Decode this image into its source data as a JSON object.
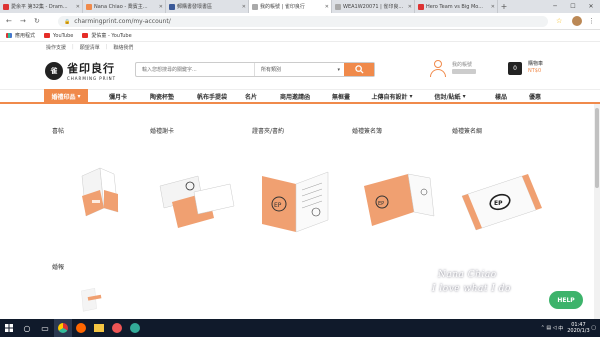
{
  "browser": {
    "tabs": [
      {
        "title": "愛余平 第32集 - Dram...",
        "color": "#d33"
      },
      {
        "title": "Nana Chiao - 喬賓主...",
        "color": "#f08a4b"
      },
      {
        "title": "郵購書發壞書區",
        "color": "#3b5998"
      },
      {
        "title": "我的帳號 | 雀印良行",
        "color": "#888"
      },
      {
        "title": "WEA1W20071 | 雀印良...",
        "color": "#888"
      },
      {
        "title": "Hero Team vs Big Mo...",
        "color": "#d33"
      }
    ],
    "new_tab": "+",
    "url": "charmingprint.com/my-account/",
    "bookmarks": [
      {
        "label": "應用程式",
        "color": "#d33"
      },
      {
        "label": "YouTube",
        "color": "#e52d27"
      },
      {
        "label": "愛佑童 - YouTube",
        "color": "#e52d27"
      }
    ]
  },
  "site": {
    "topmenu": [
      "操作支援",
      "願望清單",
      "聯絡我們"
    ],
    "logo": {
      "zh": "雀印良行",
      "en": "CHARMING PRINT",
      "mark": "EP"
    },
    "search": {
      "placeholder": "輸入您想搜尋的關鍵字...",
      "category": "所有類別"
    },
    "user": {
      "line1": "我的帳號",
      "line2": ""
    },
    "cart": {
      "label": "購物車",
      "price": "NT$0",
      "count": "0"
    },
    "categories": [
      {
        "label": "婚禮印品",
        "active": true
      },
      {
        "label": "彌月卡",
        "active": false
      },
      {
        "label": "陶瓷杯墊",
        "active": false
      },
      {
        "label": "帆布手提袋",
        "active": false
      },
      {
        "label": "名片",
        "active": false
      },
      {
        "label": "商用邀請函",
        "active": false
      },
      {
        "label": "無框畫",
        "active": false
      },
      {
        "label": "上傳自有設計",
        "active": false
      },
      {
        "label": "信封/貼紙",
        "active": false
      },
      {
        "label": "樣品",
        "active": false
      },
      {
        "label": "優惠",
        "active": false
      }
    ],
    "products": [
      {
        "label": "喜帖"
      },
      {
        "label": "婚禮謝卡"
      },
      {
        "label": "證書夾/書約"
      },
      {
        "label": "婚禮簽名簿"
      },
      {
        "label": "婚禮簽名綢"
      },
      {
        "label": "婚報"
      }
    ],
    "watermark": [
      "Nana Chiao",
      "I love what I do"
    ],
    "help": "HELP"
  },
  "taskbar": {
    "time": "01:47",
    "date": "2020/1/3"
  },
  "colors": {
    "accent": "#f08a4b",
    "taskbar": "#101a2b",
    "help": "#3db36b"
  }
}
